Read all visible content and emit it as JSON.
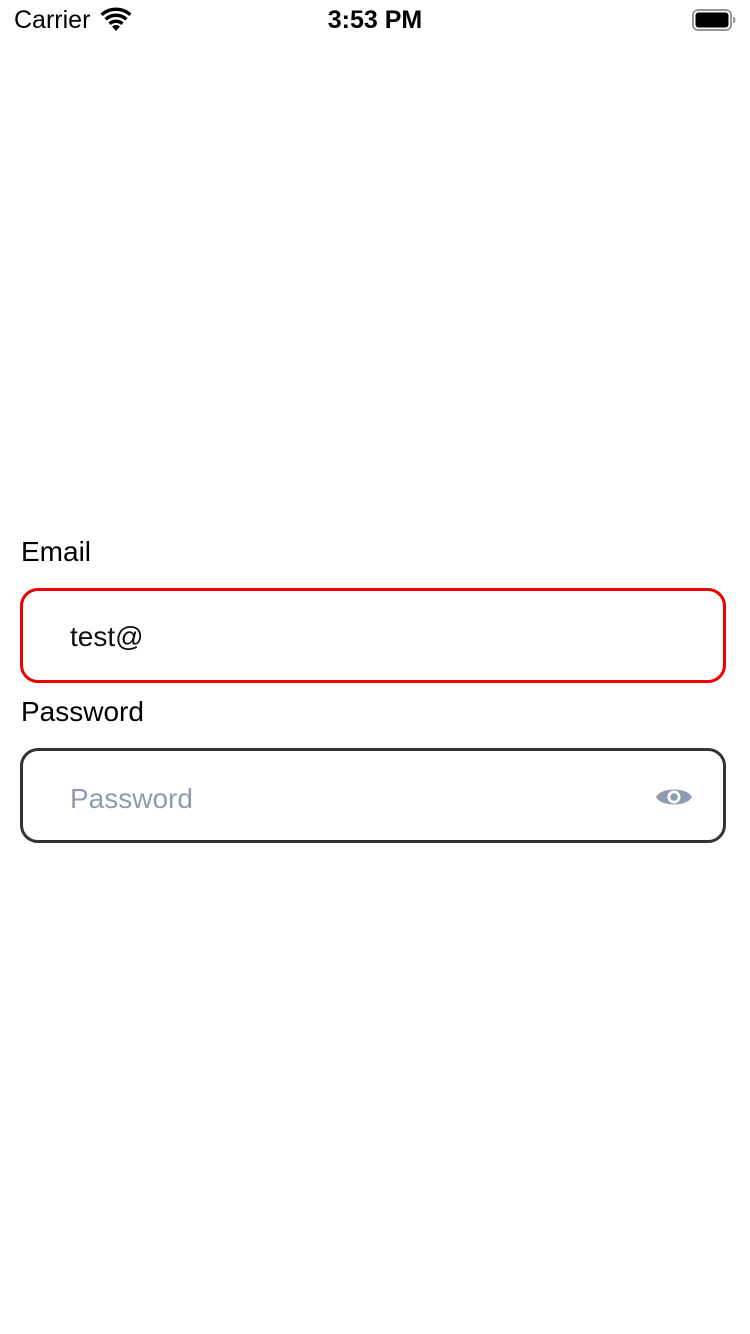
{
  "status_bar": {
    "carrier": "Carrier",
    "time": "3:53 PM",
    "wifi_icon": "wifi-icon",
    "battery_icon": "battery-full-icon"
  },
  "form": {
    "email": {
      "label": "Email",
      "value": "test@",
      "state": "error",
      "border_color": "#ee0000"
    },
    "password": {
      "label": "Password",
      "placeholder": "Password",
      "value": "",
      "toggle_icon": "eye-icon",
      "border_color": "#333333",
      "placeholder_color": "#8f9bb0"
    }
  }
}
